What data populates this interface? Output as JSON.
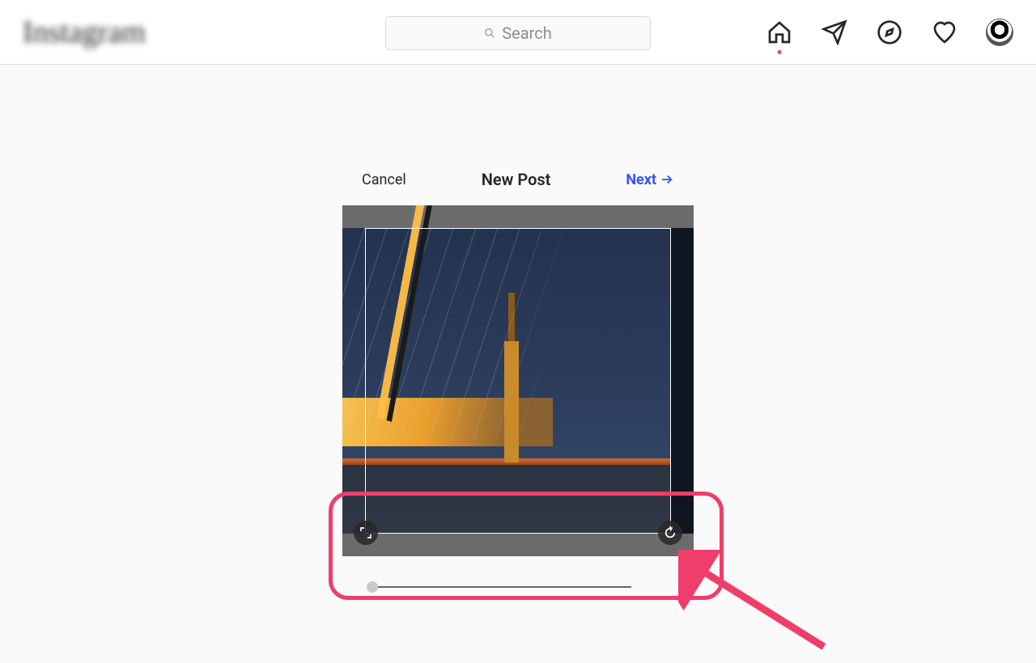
{
  "header": {
    "logo_text": "Instagram",
    "search_placeholder": "Search"
  },
  "nav": {
    "home": "home-icon",
    "messages": "send-icon",
    "explore": "compass-icon",
    "activity": "heart-icon",
    "profile": "avatar"
  },
  "new_post": {
    "cancel_label": "Cancel",
    "title": "New Post",
    "next_label": "Next",
    "expand_icon": "expand-icon",
    "rotate_icon": "rotate-icon",
    "zoom_value": 0
  },
  "annotation": {
    "highlight": "zoom-and-crop-controls",
    "arrow": "pointer-arrow"
  }
}
